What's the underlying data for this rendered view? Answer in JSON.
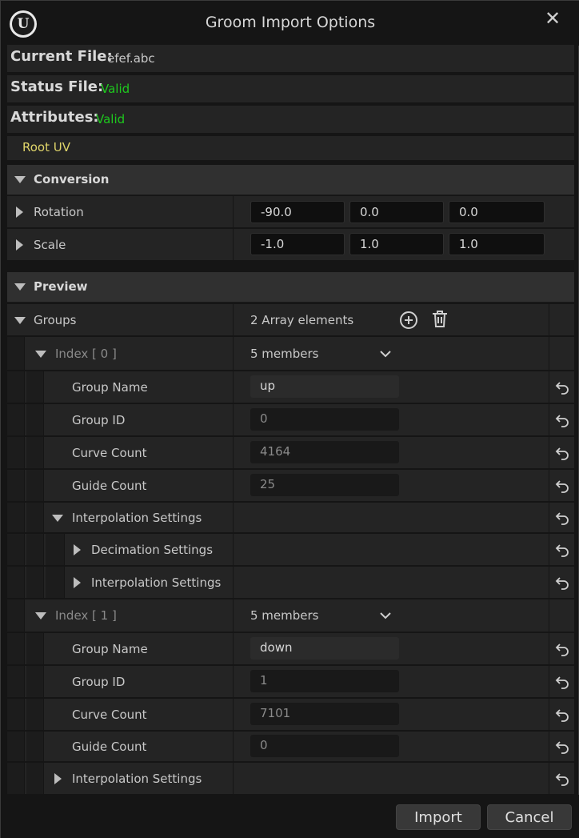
{
  "window": {
    "title": "Groom Import Options",
    "logo_text": "U",
    "close_glyph": "✕"
  },
  "info": {
    "current_file_label": "Current File:",
    "current_file_value": "efef.abc",
    "status_file_label": "Status File:",
    "status_file_value": "Valid",
    "attributes_label": "Attributes:",
    "attributes_value": "Valid",
    "root_uv": "Root UV"
  },
  "conversion": {
    "title": "Conversion",
    "rotation": {
      "label": "Rotation",
      "x": "-90.0",
      "y": "0.0",
      "z": "0.0"
    },
    "scale": {
      "label": "Scale",
      "x": "-1.0",
      "y": "1.0",
      "z": "1.0"
    }
  },
  "preview": {
    "title": "Preview",
    "groups_label": "Groups",
    "groups_count": "2 Array elements",
    "groups": [
      {
        "index_label": "Index [ 0 ]",
        "members": "5 members",
        "group_name_label": "Group Name",
        "group_name": "up",
        "group_id_label": "Group ID",
        "group_id": "0",
        "curve_count_label": "Curve Count",
        "curve_count": "4164",
        "guide_count_label": "Guide Count",
        "guide_count": "25",
        "interp_label": "Interpolation Settings",
        "decimation_label": "Decimation Settings",
        "interp_sub_label": "Interpolation Settings"
      },
      {
        "index_label": "Index [ 1 ]",
        "members": "5 members",
        "group_name_label": "Group Name",
        "group_name": "down",
        "group_id_label": "Group ID",
        "group_id": "1",
        "curve_count_label": "Curve Count",
        "curve_count": "7101",
        "guide_count_label": "Guide Count",
        "guide_count": "0",
        "interp_label": "Interpolation Settings"
      }
    ]
  },
  "buttons": {
    "import": "Import",
    "cancel": "Cancel"
  },
  "colors": {
    "valid": "#1ec81e",
    "root_uv": "#e0d56a",
    "background": "#151515",
    "panel": "#242424"
  }
}
